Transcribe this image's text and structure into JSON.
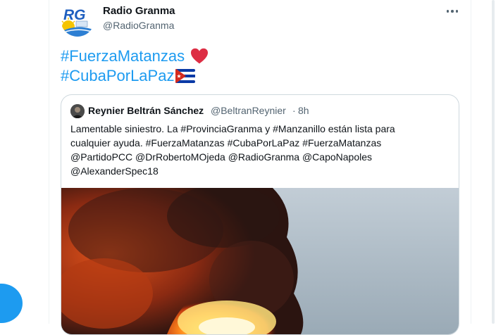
{
  "tweet": {
    "author_name": "Radio Granma",
    "author_handle": "@RadioGranma",
    "hashtag_1": "#FuerzaMatanzas",
    "hashtag_2": "#CubaPorLaPaz",
    "avatar_logo_text": "RG",
    "emoji_1": "red-heart",
    "emoji_2": "cuba-flag"
  },
  "quoted": {
    "author_name": "Reynier Beltrán Sánchez",
    "author_handle": "@BeltranReynier",
    "separator": "·",
    "time": "8h",
    "text_lines": [
      "Lamentable siniestro. La  #ProvinciaGranma y #Manzanillo están lista para",
      "cualquier ayuda.  #FuerzaMatanzas #CubaPorLaPaz #FuerzaMatanzas",
      "@PartidoPCC @DrRobertoMOjeda @RadioGranma @CapoNapoles",
      "@AlexanderSpec18"
    ],
    "image": "fire-and-smoke-photo"
  },
  "colors": {
    "link": "#1d9bf0",
    "text": "#0f1419",
    "secondary": "#536471",
    "border": "#cfd9de",
    "fab": "#1d9bf0"
  }
}
